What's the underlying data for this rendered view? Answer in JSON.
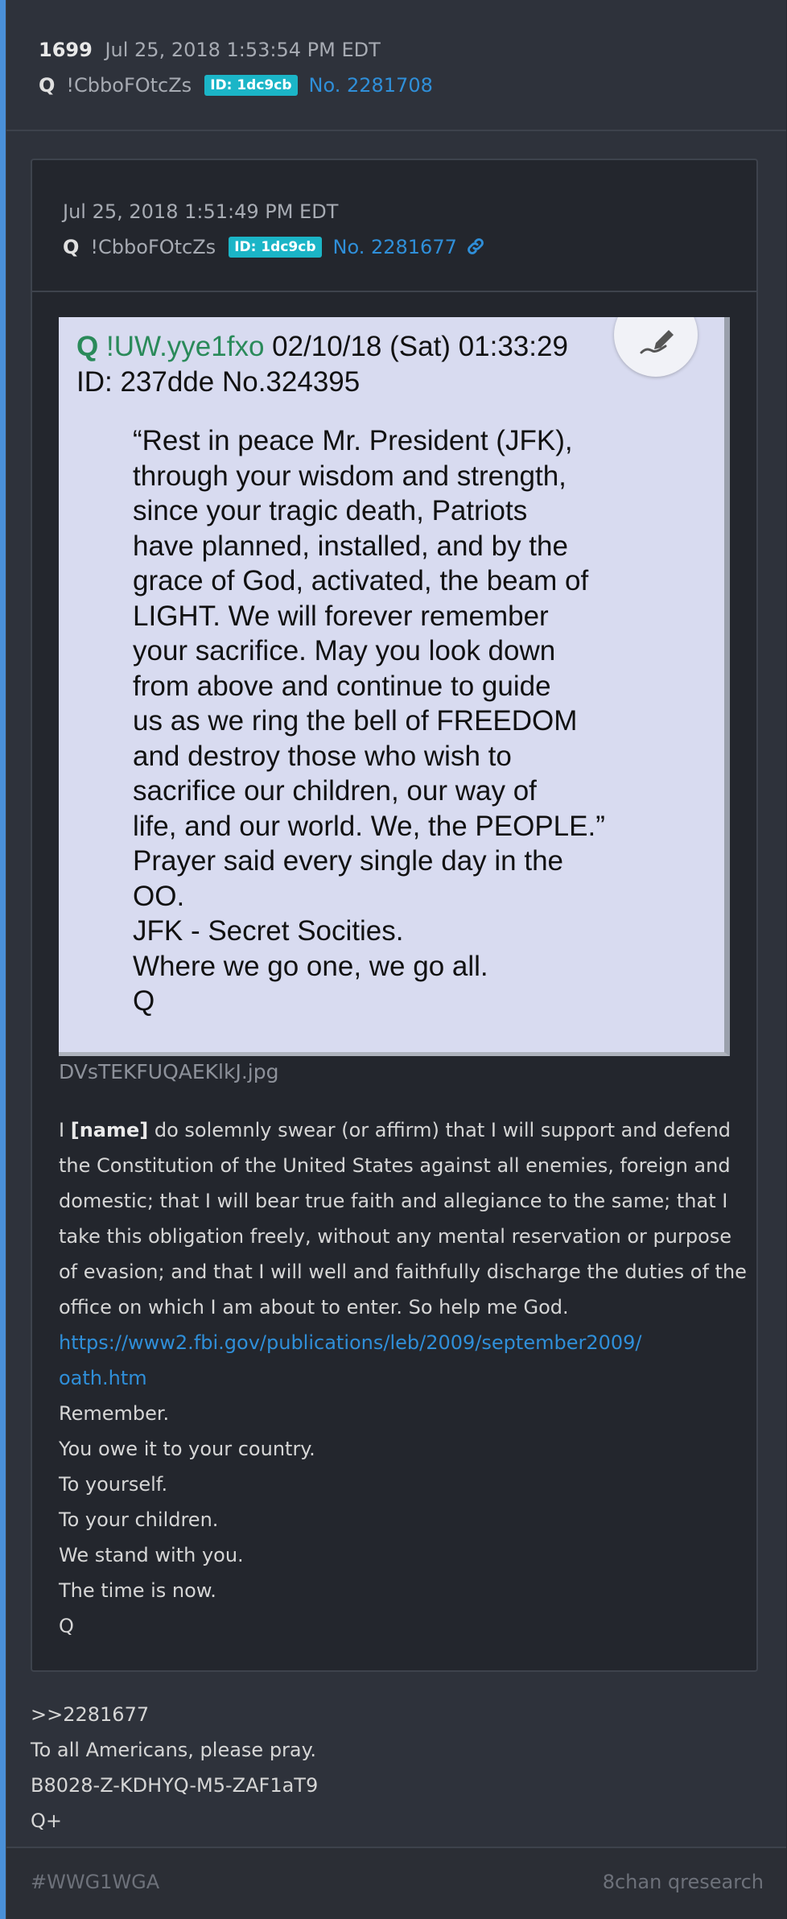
{
  "post": {
    "number": "1699",
    "date": "Jul 25, 2018 1:53:54 PM EDT",
    "author": "Q",
    "trip": "!CbboFOtcZs",
    "id_badge": "ID: 1dc9cb",
    "post_no": "No. 2281708"
  },
  "quoted": {
    "date": "Jul 25, 2018 1:51:49 PM EDT",
    "author": "Q",
    "trip": "!CbboFOtcZs",
    "id_badge": "ID: 1dc9cb",
    "post_no": "No. 2281677",
    "image": {
      "line1_q": "Q",
      "line1_trip": "!UW.yye1fxo",
      "line1_rest": "02/10/18 (Sat) 01:33:29",
      "line2": "ID: 237dde No.324395",
      "body_lines": [
        "“Rest in peace Mr. President (JFK),",
        "through your wisdom and strength,",
        "since your tragic death, Patriots",
        "have planned, installed, and by the",
        "grace of God, activated, the beam of",
        "LIGHT. We will forever remember",
        "your sacrifice. May you look down",
        "from above and continue to guide",
        "us as we ring the bell of FREEDOM",
        "and destroy those who wish to",
        "sacrifice our children, our way of",
        "life, and our world. We, the PEOPLE.”",
        "Prayer said every single day in the",
        "OO.",
        "JFK - Secret Socities.",
        "Where we go one, we go all.",
        "Q"
      ],
      "pen_icon": "signature-pen-icon"
    },
    "filename": "DVsTEKFUQAEKlkJ.jpg",
    "oath_prefix": "I ",
    "oath_name": "[name]",
    "oath_text": " do solemnly swear (or affirm) that I will support and defend the Constitution of the United States against all enemies, foreign and domestic; that I will bear true faith and allegiance to the same; that I take this obligation freely, without any mental reservation or purpose of evasion; and that I will well and faithfully discharge the duties of the office on which I am about to enter. So help me God.",
    "link_line1": "https://www2.fbi.gov/publications/leb/2009/september2009/",
    "link_line2": "oath.htm",
    "lines": [
      "Remember.",
      "You owe it to your country.",
      "To yourself.",
      "To your children.",
      "We stand with you.",
      "The time is now.",
      "Q"
    ]
  },
  "reply": {
    "lines": [
      ">>2281677",
      "To all Americans, please pray.",
      "B8028-Z-KDHYQ-M5-ZAF1aT9",
      "Q+"
    ]
  },
  "footer": {
    "left": "#WWG1WGA",
    "right": "8chan qresearch"
  },
  "colors": {
    "accent": "#4a90d9",
    "badge": "#1bb5c7",
    "link": "#2f8fd9",
    "q_green": "#2a8a5a"
  }
}
